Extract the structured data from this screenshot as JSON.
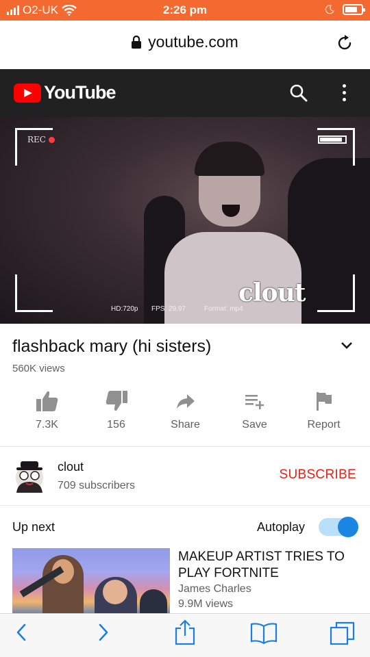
{
  "status_bar": {
    "carrier": "O2-UK",
    "time": "2:26 pm",
    "battery_level": 0.75
  },
  "browser": {
    "url": "youtube.com",
    "icons": [
      "lock-icon",
      "reload-icon"
    ]
  },
  "youtube_header": {
    "logo_text": "YouTube",
    "icons": [
      "search-icon",
      "more-vert-icon"
    ],
    "colors": {
      "bar": "#212121",
      "logo_red": "#ff0000"
    }
  },
  "video": {
    "rec_label": "REC",
    "overlay_watermark": "clout",
    "meta": {
      "hd": "HD:720p",
      "fps": "FPS: 29.97",
      "format": "Format: mp4"
    }
  },
  "video_info": {
    "title": "flashback mary (hi sisters)",
    "views": "560K views"
  },
  "actions": [
    {
      "icon": "thumb-up-icon",
      "label": "7.3K"
    },
    {
      "icon": "thumb-down-icon",
      "label": "156"
    },
    {
      "icon": "share-icon",
      "label": "Share"
    },
    {
      "icon": "playlist-add-icon",
      "label": "Save"
    },
    {
      "icon": "flag-icon",
      "label": "Report"
    }
  ],
  "channel": {
    "name": "clout",
    "subscribers": "709 subscribers",
    "subscribe_label": "SUBSCRIBE",
    "subscribe_color": "#e62117"
  },
  "up_next": {
    "heading": "Up next",
    "autoplay_label": "Autoplay",
    "autoplay_on": true,
    "item": {
      "title": "MAKEUP ARTIST TRIES TO PLAY FORTNITE",
      "channel": "James Charles",
      "views": "9.9M views"
    }
  },
  "safari_toolbar": {
    "icons": [
      "back-icon",
      "forward-icon",
      "share-icon",
      "bookmarks-icon",
      "tabs-icon"
    ],
    "accent": "#1a7ee6"
  }
}
